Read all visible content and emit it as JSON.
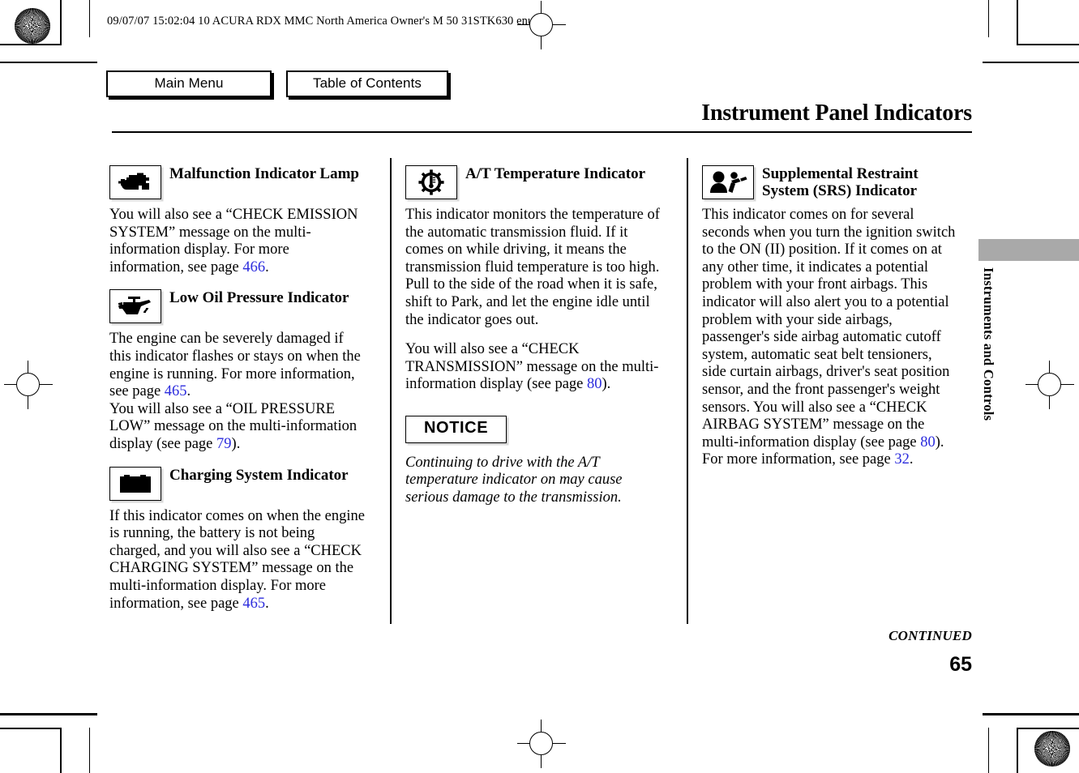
{
  "header": {
    "meta": "09/07/07 15:02:04    10 ACURA RDX MMC North America Owner's M 50 31STK630 enu",
    "title": "Instrument Panel Indicators"
  },
  "nav": {
    "main_menu": "Main Menu",
    "table_of_contents": "Table of Contents"
  },
  "columns": [
    {
      "sections": [
        {
          "icon": "malfunction-indicator-lamp-icon",
          "title": "Malfunction Indicator Lamp",
          "paragraphs": [
            "You will also see a “CHECK EMISSION SYSTEM” message on the multi-information display. For more information, see page 466."
          ]
        },
        {
          "icon": "low-oil-pressure-icon",
          "title": "Low Oil Pressure Indicator",
          "paragraphs": [
            "The engine can be severely damaged if this indicator flashes or stays on when the engine is running. For more information, see page 465.",
            "You will also see a “OIL PRESSURE LOW” message on the multi-information display (see page 79)."
          ]
        },
        {
          "icon": "charging-system-icon",
          "title": "Charging System Indicator",
          "paragraphs": [
            "If this indicator comes on when the engine is running, the battery is not being charged, and you will also see a “CHECK CHARGING SYSTEM” message on the multi-information display. For more information, see page 465."
          ]
        }
      ]
    },
    {
      "sections": [
        {
          "icon": "at-temperature-icon",
          "title": "A/T Temperature Indicator",
          "paragraphs": [
            "This indicator monitors the temperature of the automatic transmission fluid. If it comes on while driving, it means the transmission fluid temperature is too high. Pull to the side of the road when it is safe, shift to Park, and let the engine idle until the indicator goes out.",
            "You will also see a “CHECK TRANSMISSION” message on the multi-information display (see page 80)."
          ]
        }
      ],
      "notice": {
        "label": "NOTICE",
        "text": "Continuing to drive with the A/T temperature indicator on may cause serious damage to the transmission."
      }
    },
    {
      "sections": [
        {
          "icon": "srs-airbag-icon",
          "title": "Supplemental Restraint System (SRS) Indicator",
          "paragraphs": [
            "This indicator comes on for several seconds when you turn the ignition switch to the ON (II) position. If it comes on at any other time, it indicates a potential problem with your front airbags. This indicator will also alert you to a potential problem with your side airbags, passenger's side airbag automatic cutoff system, automatic seat belt tensioners, side curtain airbags, driver's seat position sensor, and the front passenger's weight sensors. You will also see a “CHECK AIRBAG SYSTEM” message on the multi-information display (see page 80). For more information, see page 32."
          ]
        }
      ]
    }
  ],
  "page_refs": {
    "mil": "466",
    "oil_1": "465",
    "oil_2": "79",
    "charging": "465",
    "at_temp": "80",
    "srs_1": "80",
    "srs_2": "32"
  },
  "side_tab": {
    "label": "Instruments and Controls",
    "color": "#a9a9a9"
  },
  "footer": {
    "continued": "CONTINUED",
    "page_number": "65"
  },
  "text_runs": {
    "mil_p_a": "You will also see a “CHECK EMISSION SYSTEM” message on the multi-information display. For more information, see page ",
    "mil_p_b": ".",
    "oil_p1_a": "The engine can be severely damaged if this indicator flashes or stays on when the engine is running. For more information, see page ",
    "oil_p1_b": ".",
    "oil_p2_a": "You will also see a “OIL PRESSURE LOW” message on the multi-information display (see page ",
    "oil_p2_b": ").",
    "chg_p_a": "If this indicator comes on when the engine is running, the battery is not being charged, and you will also see a “CHECK CHARGING SYSTEM” message on the multi-information display. For more information, see page ",
    "chg_p_b": ".",
    "at_p1": "This indicator monitors the temperature of the automatic transmission fluid. If it comes on while driving, it means the transmission fluid temperature is too high. Pull to the side of the road when it is safe, shift to Park, and let the engine idle until the indicator goes out.",
    "at_p2_a": "You will also see a “CHECK TRANSMISSION” message on the multi-information display (see page ",
    "at_p2_b": ").",
    "srs_a": "This indicator comes on for several seconds when you turn the ignition switch to the ON (II) position. If it comes on at any other time, it indicates a potential problem with your front airbags. This indicator will also alert you to a potential problem with your side airbags, passenger's side airbag automatic cutoff system, automatic seat belt tensioners, side curtain airbags, driver's seat position sensor, and the front passenger's weight sensors. You will also see a “CHECK AIRBAG SYSTEM” message on the multi-information display (see page ",
    "srs_mid": "). For more information, see page ",
    "srs_end": "."
  }
}
